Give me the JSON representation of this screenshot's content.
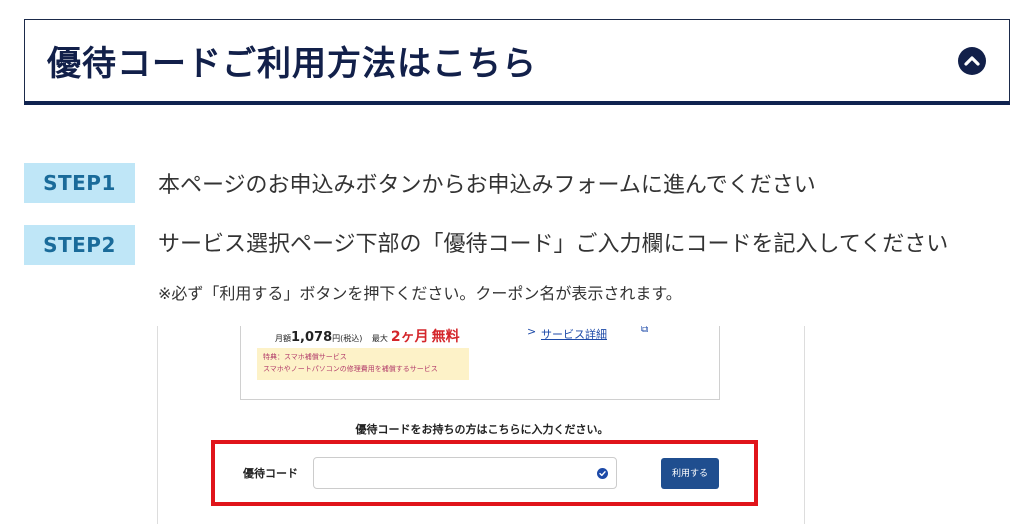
{
  "accordion": {
    "title": "優待コードご利用方法はこちら",
    "toggle_icon": "chevron-up-circle-icon"
  },
  "steps": [
    {
      "label": "STEP1",
      "text": "本ページのお申込みボタンからお申込みフォームに進んでください"
    },
    {
      "label": "STEP2",
      "text": "サービス選択ページ下部の「優待コード」ご入力欄にコードを記入してください"
    }
  ],
  "note": "※必ず「利用する」ボタンを押下ください。クーポン名が表示されます。",
  "example_screenshot": {
    "price_prefix": "月額",
    "price_value": "1,078",
    "price_unit": "円(税込)",
    "max_prefix": "最大",
    "max_value": "2ヶ月",
    "free_label": "無料",
    "detail_link": "サービス詳細",
    "benefit_title": "特典：スマホ補償サービス",
    "benefit_desc": "スマホやノートパソコンの修理費用を補償するサービス",
    "prompt": "優待コードをお持ちの方はこちらに入力ください。",
    "code_label": "優待コード",
    "code_value": "",
    "apply_button": "利用する"
  },
  "colors": {
    "navy": "#12204a",
    "step_badge_bg": "#bfe6f7",
    "step_badge_text": "#1a6b9a",
    "highlight_red": "#e0141a",
    "button_blue": "#1f4e8f"
  }
}
